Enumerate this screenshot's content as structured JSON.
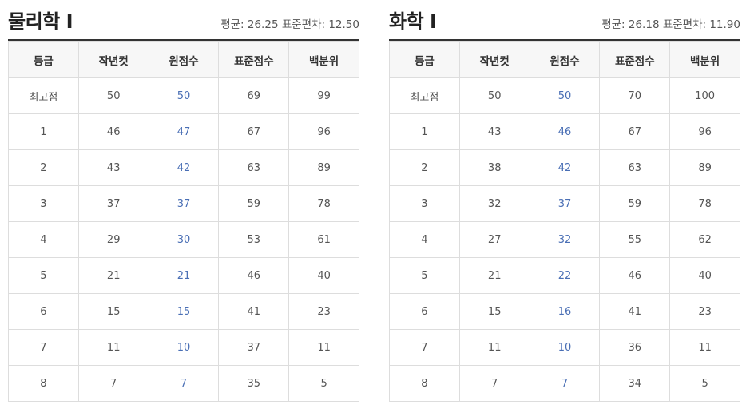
{
  "columns": [
    "등급",
    "작년컷",
    "원점수",
    "표준점수",
    "백분위"
  ],
  "colors": {
    "raw_score": "#4a6fb5",
    "header_bg": "#f7f7f7",
    "border": "#dddddd"
  },
  "panels": [
    {
      "title": "물리학 Ⅰ",
      "stats": "평균: 26.25 표준편차: 12.50",
      "rows": [
        [
          "최고점",
          "50",
          "50",
          "69",
          "99"
        ],
        [
          "1",
          "46",
          "47",
          "67",
          "96"
        ],
        [
          "2",
          "43",
          "42",
          "63",
          "89"
        ],
        [
          "3",
          "37",
          "37",
          "59",
          "78"
        ],
        [
          "4",
          "29",
          "30",
          "53",
          "61"
        ],
        [
          "5",
          "21",
          "21",
          "46",
          "40"
        ],
        [
          "6",
          "15",
          "15",
          "41",
          "23"
        ],
        [
          "7",
          "11",
          "10",
          "37",
          "11"
        ],
        [
          "8",
          "7",
          "7",
          "35",
          "5"
        ]
      ]
    },
    {
      "title": "화학 Ⅰ",
      "stats": "평균: 26.18 표준편차: 11.90",
      "rows": [
        [
          "최고점",
          "50",
          "50",
          "70",
          "100"
        ],
        [
          "1",
          "43",
          "46",
          "67",
          "96"
        ],
        [
          "2",
          "38",
          "42",
          "63",
          "89"
        ],
        [
          "3",
          "32",
          "37",
          "59",
          "78"
        ],
        [
          "4",
          "27",
          "32",
          "55",
          "62"
        ],
        [
          "5",
          "21",
          "22",
          "46",
          "40"
        ],
        [
          "6",
          "15",
          "16",
          "41",
          "23"
        ],
        [
          "7",
          "11",
          "10",
          "36",
          "11"
        ],
        [
          "8",
          "7",
          "7",
          "34",
          "5"
        ]
      ]
    }
  ]
}
